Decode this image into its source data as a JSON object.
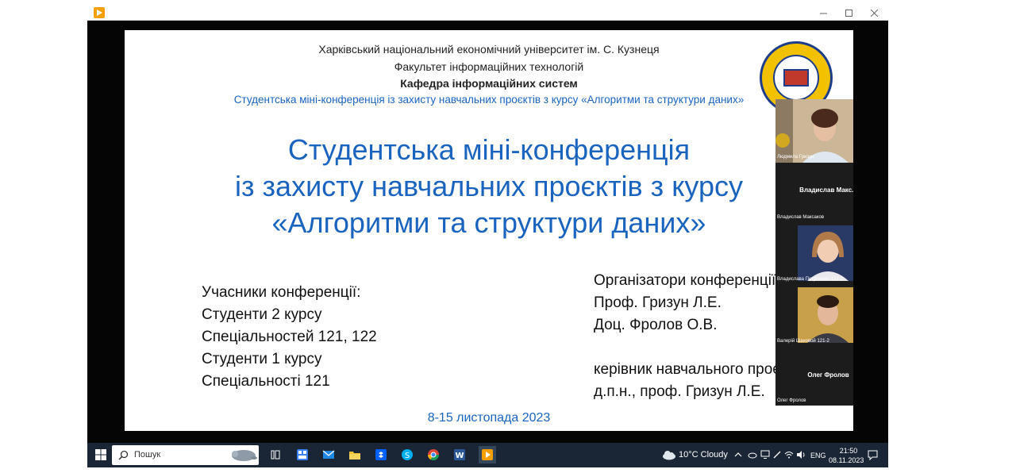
{
  "slide": {
    "header": {
      "line1": "Харківський національний економічний університет ім. С. Кузнеця",
      "line2": "Факультет інформаційних технологій",
      "line3": "Кафедра інформаційних систем",
      "line4": "Студентська міні-конференція із захисту навчальних проєктів з курсу «Алгоритми та структури даних»"
    },
    "title": {
      "line1": "Студентська міні-конференція",
      "line2": "із захисту навчальних проєктів з курсу",
      "line3": "«Алгоритми та структури даних»"
    },
    "participants": {
      "heading": "Учасники конференції:",
      "line1": "Студенти 2 курсу",
      "line2": "Спеціальностей 121, 122",
      "line3": "Студенти 1 курсу",
      "line4": "Спеціальності 121"
    },
    "organizers": {
      "heading": "Організатори конференції:",
      "line1": "Проф. Гризун Л.Е.",
      "line2": "Доц. Фролов О.В.",
      "line3": "керівник навчального проєкту:",
      "line4": "д.п.н., проф. Гризун Л.Е."
    },
    "date": "8-15 листопада 2023"
  },
  "participants_panel": {
    "tiles": [
      {
        "name": "Людмила Гризун",
        "type": "video"
      },
      {
        "center_label": "Владислав  Макс...",
        "name": "Владислав Максаков",
        "type": "text"
      },
      {
        "name": "Владислава Петріченко 121-2",
        "type": "video"
      },
      {
        "name": "Валерій Шаховой 121-2",
        "type": "video"
      },
      {
        "center_label": "Олег Фролов",
        "name": "Олег Фролов",
        "type": "text"
      }
    ]
  },
  "taskbar": {
    "search_placeholder": "Пошук",
    "weather": "10°C  Cloudy",
    "language": "ENG",
    "time": "21:50",
    "date": "08.11.2023"
  },
  "colors": {
    "accent_blue": "#1a64c0",
    "taskbar": "#1a2635"
  }
}
